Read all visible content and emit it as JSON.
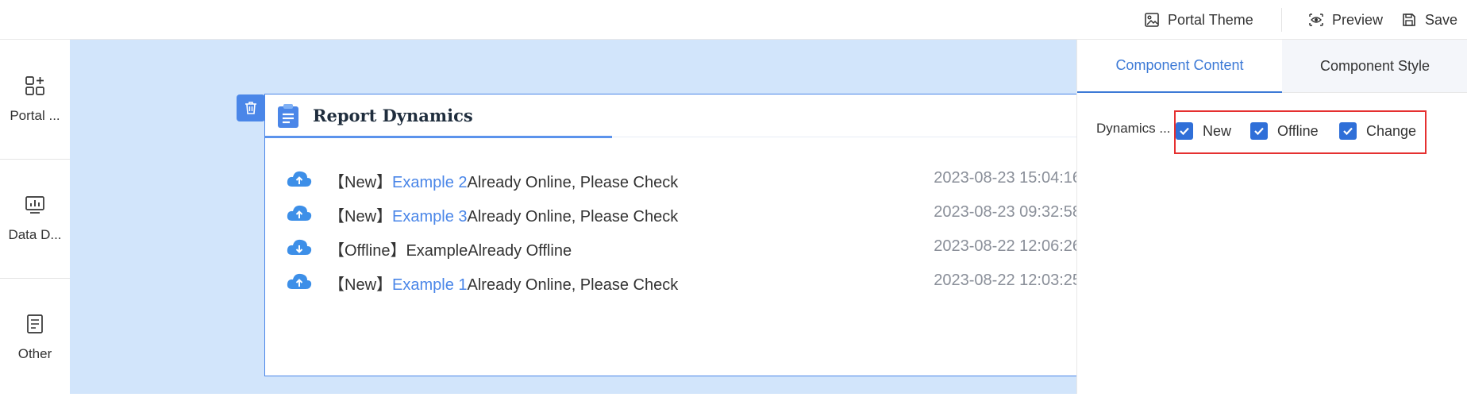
{
  "topbar": {
    "portal_theme": "Portal Theme",
    "preview": "Preview",
    "save": "Save"
  },
  "sidebar": {
    "items": [
      {
        "label": "Portal ...",
        "icon": "add-component-icon"
      },
      {
        "label": "Data D...",
        "icon": "chart-board-icon"
      },
      {
        "label": "Other",
        "icon": "document-icon"
      }
    ]
  },
  "card": {
    "title": "Report Dynamics",
    "rows": [
      {
        "prefix": "【New】",
        "link": "Example 2",
        "suffix": "Already Online, Please Check",
        "time": "2023-08-23 15:04:16",
        "icon": "cloud-upload-icon"
      },
      {
        "prefix": "【New】",
        "link": "Example 3",
        "suffix": "Already Online, Please Check",
        "time": "2023-08-23 09:32:58",
        "icon": "cloud-upload-icon"
      },
      {
        "prefix": "【Offline】ExampleAlready Offline",
        "link": "",
        "suffix": "",
        "time": "2023-08-22 12:06:26",
        "icon": "cloud-download-icon"
      },
      {
        "prefix": "【New】",
        "link": "Example 1",
        "suffix": "Already Online, Please Check",
        "time": "2023-08-22 12:03:25",
        "icon": "cloud-upload-icon"
      }
    ]
  },
  "panel": {
    "tabs": [
      {
        "label": "Component Content",
        "active": true
      },
      {
        "label": "Component Style",
        "active": false
      }
    ],
    "field_label": "Dynamics ...",
    "checkboxes": [
      {
        "label": "New",
        "checked": true
      },
      {
        "label": "Offline",
        "checked": true
      },
      {
        "label": "Change",
        "checked": true
      }
    ]
  },
  "colors": {
    "accent": "#4a86e8",
    "canvas": "#d2e5fb",
    "highlight": "#e53030"
  }
}
